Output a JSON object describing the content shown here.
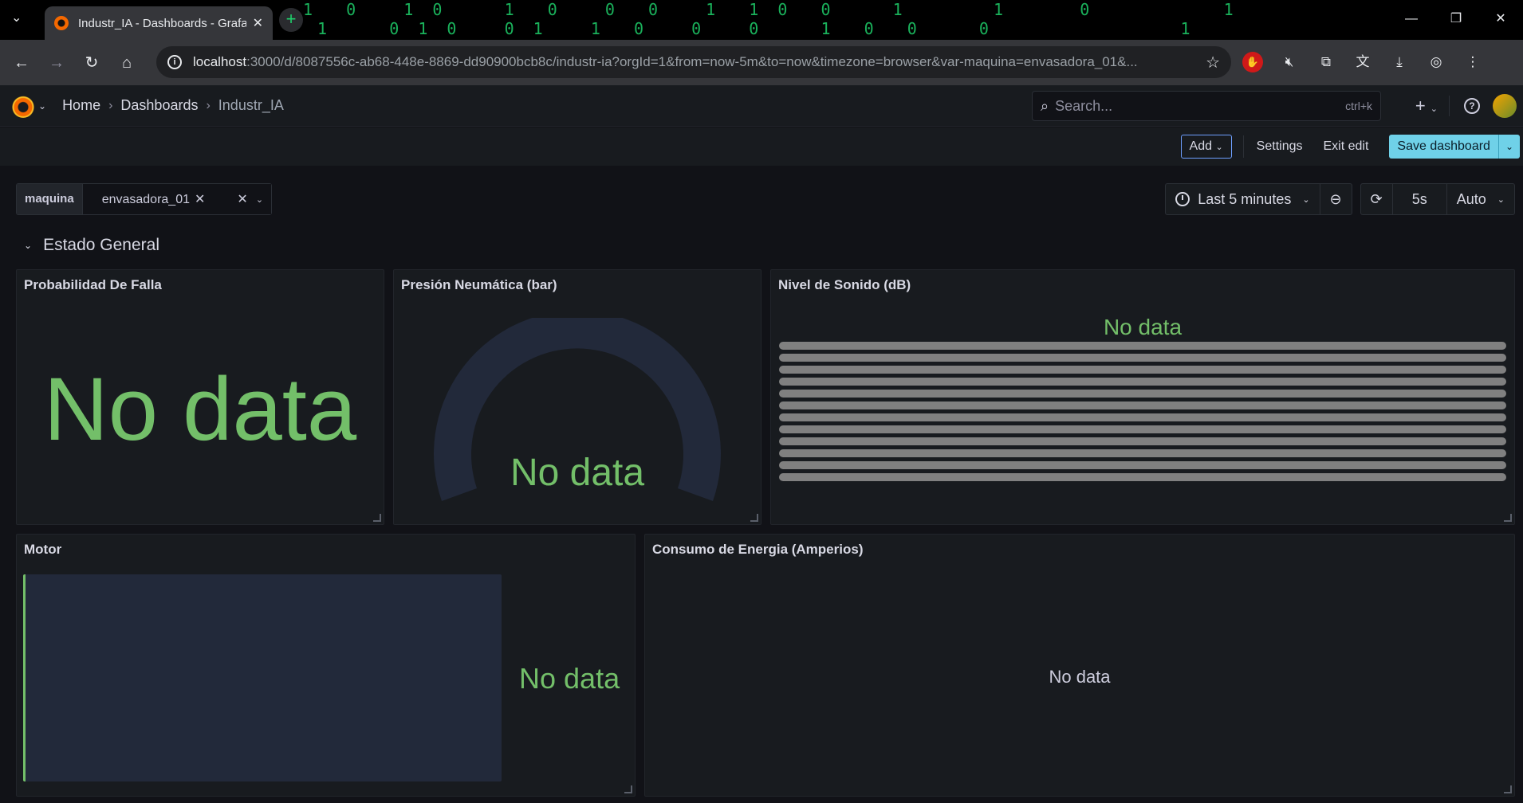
{
  "browser": {
    "tab_title": "Industr_IA - Dashboards - Grafana",
    "url_host": "localhost",
    "url_rest": ":3000/d/8087556c-ab68-448e-8869-dd90900bcb8c/industr-ia?orgId=1&from=now-5m&to=now&timezone=browser&var-maquina=envasadora_01&..."
  },
  "topnav": {
    "breadcrumbs": [
      {
        "label": "Home"
      },
      {
        "label": "Dashboards"
      },
      {
        "label": "Industr_IA"
      }
    ],
    "search_placeholder": "Search...",
    "search_shortcut": "ctrl+k"
  },
  "editbar": {
    "add_label": "Add",
    "settings_label": "Settings",
    "exit_label": "Exit edit",
    "save_label": "Save dashboard"
  },
  "variables": {
    "label": "maquina",
    "value": "envasadora_01"
  },
  "time": {
    "range_label": "Last 5 minutes",
    "refresh_interval": "5s",
    "auto_label": "Auto"
  },
  "row": {
    "title": "Estado General"
  },
  "panels": {
    "prob": {
      "title": "Probabilidad De Falla",
      "message": "No data"
    },
    "presion": {
      "title": "Presión Neumática (bar)",
      "message": "No data"
    },
    "sonido": {
      "title": "Nivel de Sonido (dB)",
      "message": "No data"
    },
    "motor": {
      "title": "Motor",
      "message": "No data"
    },
    "energia": {
      "title": "Consumo de Energia (Amperios)",
      "message": "No data"
    }
  },
  "colors": {
    "nodata_green": "#73bf69",
    "save_button": "#6fd1e8",
    "panel_bg": "#181b1f"
  }
}
